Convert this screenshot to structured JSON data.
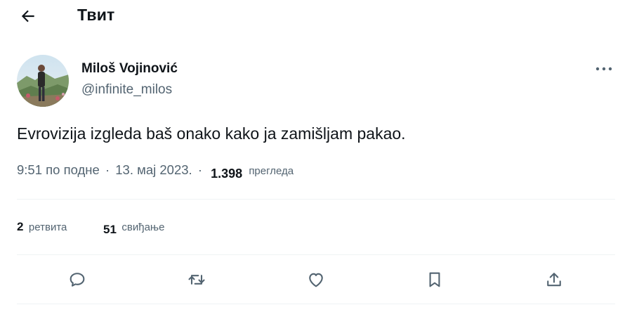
{
  "header": {
    "title": "Твит"
  },
  "author": {
    "name": "Miloš Vojinović",
    "handle": "@infinite_milos"
  },
  "tweet": {
    "text": "Evrovizija izgleda baš onako kako ja zamišljam pakao.",
    "time": "9:51 по подне",
    "separator": "·",
    "date": "13. мај 2023.",
    "views_count": "1.398",
    "views_label": "прегледа"
  },
  "stats": {
    "retweets_count": "2",
    "retweets_label": "ретвита",
    "likes_count": "51",
    "likes_label": "свиђање"
  },
  "icons": {
    "back": "arrow-left-icon",
    "more": "more-horizontal-icon",
    "reply": "reply-bubble-icon",
    "retweet": "retweet-icon",
    "like": "heart-icon",
    "bookmark": "bookmark-icon",
    "share": "share-upload-icon"
  },
  "colors": {
    "text_primary": "#0f1419",
    "text_secondary": "#536471",
    "divider": "#eff3f4"
  }
}
